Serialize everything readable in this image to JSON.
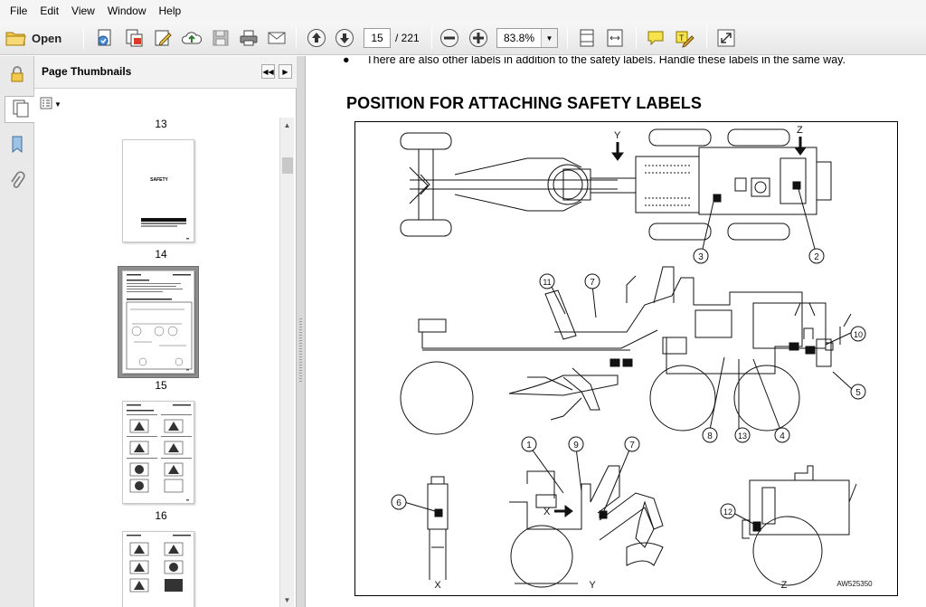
{
  "menu": [
    "File",
    "Edit",
    "View",
    "Window",
    "Help"
  ],
  "toolbar": {
    "open_label": "Open",
    "current_page": "15",
    "page_total": "/ 221",
    "zoom": "83.8%"
  },
  "panel": {
    "title": "Page Thumbnails",
    "thumbnails": [
      {
        "page": "13"
      },
      {
        "page": "14",
        "text": "SAFETY"
      },
      {
        "page": "15"
      },
      {
        "page": "16"
      }
    ]
  },
  "document": {
    "bullet_text": "There are also other labels in addition to the safety labels.  Handle these labels in the same way.",
    "section_title": "POSITION FOR ATTACHING SAFETY LABELS",
    "figure": {
      "view_markers": [
        "Y",
        "Z"
      ],
      "label_numbers": [
        "1",
        "2",
        "3",
        "4",
        "5",
        "6",
        "7",
        "8",
        "9",
        "10",
        "11",
        "12",
        "13"
      ],
      "side_marker": "X",
      "view_captions": [
        "X",
        "Y",
        "Z"
      ],
      "figure_code": "AW525350"
    }
  }
}
